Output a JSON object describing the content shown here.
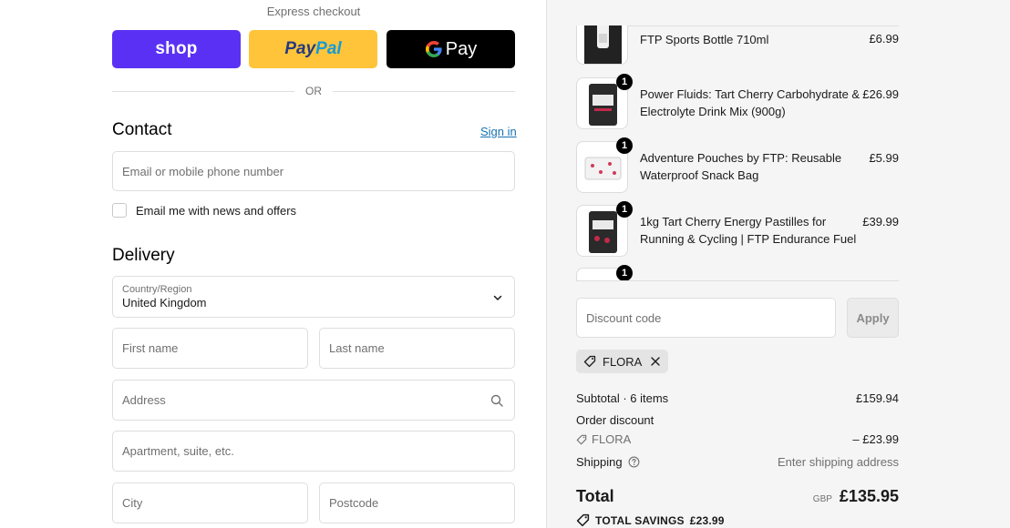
{
  "express": {
    "label": "Express checkout",
    "shop_label": "shop",
    "paypal_part1": "Pay",
    "paypal_part2": "Pal",
    "gpay_g": "G",
    "gpay_label": "Pay",
    "or_text": "OR"
  },
  "contact": {
    "title": "Contact",
    "sign_in": "Sign in",
    "email_placeholder": "Email or mobile phone number",
    "newsletter_label": "Email me with news and offers",
    "newsletter_checked": false
  },
  "delivery": {
    "title": "Delivery",
    "country_label": "Country/Region",
    "country_value": "United Kingdom",
    "first_name_placeholder": "First name",
    "last_name_placeholder": "Last name",
    "address_placeholder": "Address",
    "apartment_placeholder": "Apartment, suite, etc.",
    "city_placeholder": "City",
    "postcode_placeholder": "Postcode"
  },
  "cart": {
    "items": [
      {
        "name": "FTP Sports Bottle 710ml",
        "price": "£6.99",
        "quantity": ""
      },
      {
        "name": "Power Fluids: Tart Cherry Carbohydrate & Electrolyte Drink Mix (900g)",
        "price": "£26.99",
        "quantity": "1"
      },
      {
        "name": "Adventure Pouches by FTP: Reusable Waterproof Snack Bag",
        "price": "£5.99",
        "quantity": "1"
      },
      {
        "name": "1kg Tart Cherry Energy Pastilles for Running & Cycling | FTP Endurance Fuel",
        "price": "£39.99",
        "quantity": "1"
      },
      {
        "name": "",
        "price": "",
        "quantity": "1"
      }
    ]
  },
  "discount": {
    "placeholder": "Discount code",
    "apply_label": "Apply",
    "applied_code": "FLORA"
  },
  "summary": {
    "subtotal_label": "Subtotal · 6 items",
    "subtotal_value": "£159.94",
    "order_discount_label": "Order discount",
    "discount_code": "FLORA",
    "discount_value": "– £23.99",
    "shipping_label": "Shipping",
    "shipping_value": "Enter shipping address",
    "total_label": "Total",
    "currency": "GBP",
    "total_value": "£135.95",
    "savings_label": "TOTAL SAVINGS",
    "savings_value": "£23.99"
  },
  "colors": {
    "shop_purple": "#5a31f4",
    "paypal_yellow": "#ffc439",
    "link_blue": "#1773b0",
    "sidebar_bg": "#f5f5f5"
  }
}
